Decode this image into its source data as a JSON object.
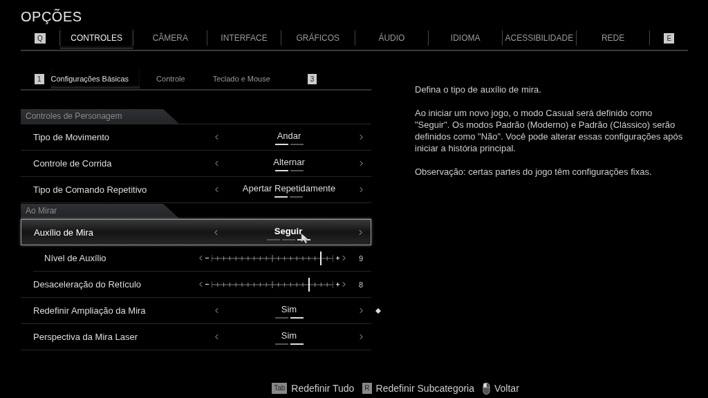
{
  "title": "OPÇÕES",
  "tabs": {
    "prev_key": "Q",
    "next_key": "E",
    "items": [
      {
        "label": "CONTROLES",
        "selected": true
      },
      {
        "label": "CÂMERA",
        "selected": false
      },
      {
        "label": "INTERFACE",
        "selected": false
      },
      {
        "label": "GRÁFICOS",
        "selected": false
      },
      {
        "label": "ÁUDIO",
        "selected": false
      },
      {
        "label": "IDIOMA",
        "selected": false
      },
      {
        "label": "ACESSIBILIDADE",
        "selected": false
      },
      {
        "label": "REDE",
        "selected": false
      }
    ]
  },
  "subtabs": {
    "prev_key": "1",
    "next_key": "3",
    "items": [
      {
        "label": "Configurações Básicas",
        "selected": true
      },
      {
        "label": "Controle",
        "selected": false
      },
      {
        "label": "Teclado e Mouse",
        "selected": false
      }
    ]
  },
  "sections": [
    {
      "title": "Controles de Personagem",
      "rows": [
        {
          "kind": "option",
          "label": "Tipo de Movimento",
          "value": "Andar",
          "selected": false,
          "marked": false,
          "segments": [
            {
              "selected": true
            },
            {
              "selected": false
            }
          ]
        },
        {
          "kind": "option",
          "label": "Controle de Corrida",
          "value": "Alternar",
          "selected": false,
          "marked": false,
          "segments": [
            {
              "selected": true
            },
            {
              "selected": false
            }
          ]
        },
        {
          "kind": "option",
          "label": "Tipo de Comando Repetitivo",
          "value": "Apertar Repetidamente",
          "selected": false,
          "marked": false,
          "segments": [
            {
              "selected": true
            },
            {
              "selected": false
            }
          ]
        }
      ]
    },
    {
      "title": "Ao Mirar",
      "rows": [
        {
          "kind": "option",
          "label": "Auxílio de Mira",
          "value": "Seguir",
          "selected": true,
          "marked": false,
          "segments": [
            {
              "selected": false
            },
            {
              "selected": false
            },
            {
              "selected": true
            }
          ],
          "children": [
            {
              "kind": "slider",
              "label": "Nível de Auxílio",
              "level": 0.9,
              "reading": "9",
              "selected": false,
              "marked": false
            }
          ]
        },
        {
          "kind": "slider",
          "label": "Desaceleração do Retículo",
          "level": 0.8,
          "reading": "8",
          "selected": false,
          "marked": false
        },
        {
          "kind": "option",
          "label": "Redefinir Ampliação da Mira",
          "value": "Sim",
          "selected": false,
          "marked": true,
          "segments": [
            {
              "selected": false
            },
            {
              "selected": true
            }
          ]
        },
        {
          "kind": "option",
          "label": "Perspectiva da Mira Laser",
          "value": "Sim",
          "selected": false,
          "marked": false,
          "segments": [
            {
              "selected": false
            },
            {
              "selected": true
            }
          ]
        }
      ]
    }
  ],
  "description": [
    "Defina o tipo de auxílio de mira.",
    "Ao iniciar um novo jogo, o modo Casual será definido como \"Seguir\". Os modos Padrão (Moderno) e Padrão (Clássico) serão definidos como \"Não\". Você pode alterar essas configurações após iniciar a história principal.",
    "Observação: certas partes do jogo têm configurações fixas."
  ],
  "footer": [
    {
      "kind": "key",
      "key": "Tab",
      "label": "Redefinir Tudo"
    },
    {
      "kind": "key",
      "key": "R",
      "label": "Redefinir Subcategoria"
    },
    {
      "kind": "mouse",
      "label": "Voltar"
    }
  ]
}
